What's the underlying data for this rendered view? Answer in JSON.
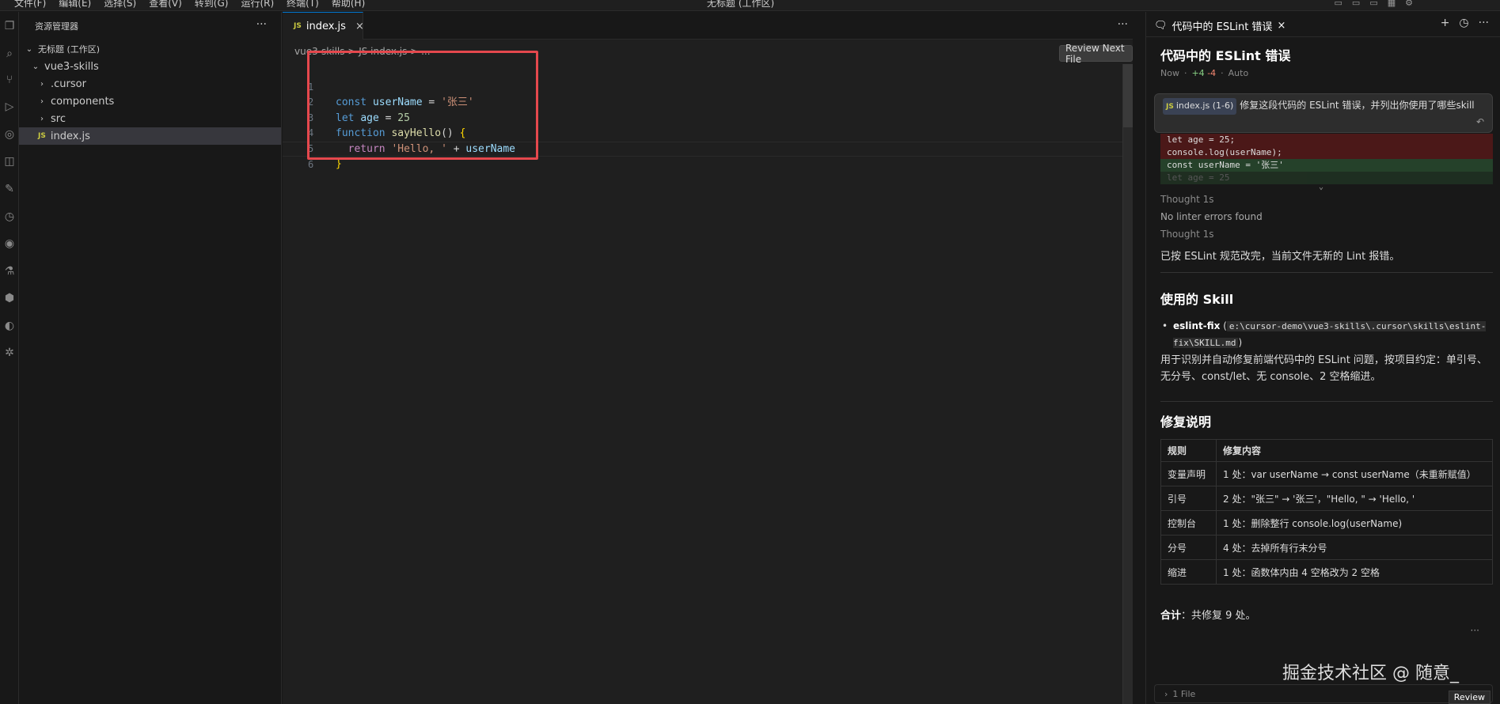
{
  "titlebar": {
    "menus": [
      "文件(F)",
      "编辑(E)",
      "选择(S)",
      "查看(V)",
      "转到(G)",
      "运行(R)",
      "终端(T)",
      "帮助(H)"
    ],
    "title": "无标题 (工作区)"
  },
  "sidebar": {
    "header": "资源管理器",
    "workspace": "无标题 (工作区)",
    "project": "vue3-skills",
    "folders": [
      ".cursor",
      "components",
      "src"
    ],
    "file": "index.js",
    "file_badge": "JS"
  },
  "editor": {
    "tab_label": "index.js",
    "tab_badge": "JS",
    "breadcrumb": "vue3-skills > JS index.js > ...",
    "review_next_label": "Review Next File",
    "line_numbers": [
      "1",
      "2",
      "3",
      "4",
      "5",
      "6"
    ],
    "code": {
      "l1": {
        "kw": "const",
        "var": "userName",
        "op": " = ",
        "str": "'张三'"
      },
      "l2": {
        "kw": "let",
        "var": "age",
        "op": " = ",
        "num": "25"
      },
      "l3": {
        "kw": "function",
        "fn": "sayHello",
        "rest": "() ",
        "brace": "{"
      },
      "l4": {
        "kw": "return",
        "str": "'Hello, '",
        "op": " + ",
        "var": "userName"
      },
      "l5": {
        "brace": "}"
      }
    }
  },
  "chat": {
    "tab_label": "代码中的 ESLint 错误",
    "title": "代码中的 ESLint 错误",
    "meta_time": "Now",
    "meta_plus": "+4",
    "meta_minus": "-4",
    "meta_mode": "Auto",
    "prompt_file_badge": "JS",
    "prompt_file": "index.js (1-6)",
    "prompt_text": "修复这段代码的 ESLint 错误，并列出你使用了哪些skill",
    "diff_lines": [
      {
        "type": "del",
        "text": "let age = 25;"
      },
      {
        "type": "del",
        "text": "console.log(userName);"
      },
      {
        "type": "add",
        "text": "const userName = '张三'"
      },
      {
        "type": "fade",
        "text": "let age = 25"
      }
    ],
    "thought1": "Thought 1s",
    "lint_result": "No linter errors found",
    "thought2": "Thought 1s",
    "summary": "已按 ESLint 规范改完，当前文件无新的 Lint 报错。",
    "skill_heading": "使用的 Skill",
    "skill_name": "eslint-fix",
    "skill_path": "e:\\cursor-demo\\vue3-skills\\.cursor\\skills\\eslint-fix\\SKILL.md",
    "skill_desc": "用于识别并自动修复前端代码中的 ESLint 问题，按项目约定：单引号、无分号、const/let、无 console、2 空格缩进。",
    "fix_heading": "修复说明",
    "table": {
      "headers": [
        "规则",
        "修复内容"
      ],
      "rows": [
        {
          "rule": "变量声明",
          "fix": "1 处：var userName → const userName（未重新赋值）"
        },
        {
          "rule": "引号",
          "fix": "2 处：\"张三\" → '张三'，\"Hello, \" → 'Hello, '"
        },
        {
          "rule": "控制台",
          "fix": "1 处：删除整行 console.log(userName)"
        },
        {
          "rule": "分号",
          "fix": "4 处：去掉所有行末分号"
        },
        {
          "rule": "缩进",
          "fix": "1 处：函数体内由 4 空格改为 2 空格"
        }
      ]
    },
    "total_label": "合计",
    "total_text": "：共修复 9 处。",
    "watermark": "掘金技术社区 @ 随意_",
    "files_label": "1 File",
    "review_label": "Review"
  },
  "colors": {
    "accent": "#0078d4",
    "highlight_box": "#e5484d",
    "js_badge": "#cbcb41"
  }
}
